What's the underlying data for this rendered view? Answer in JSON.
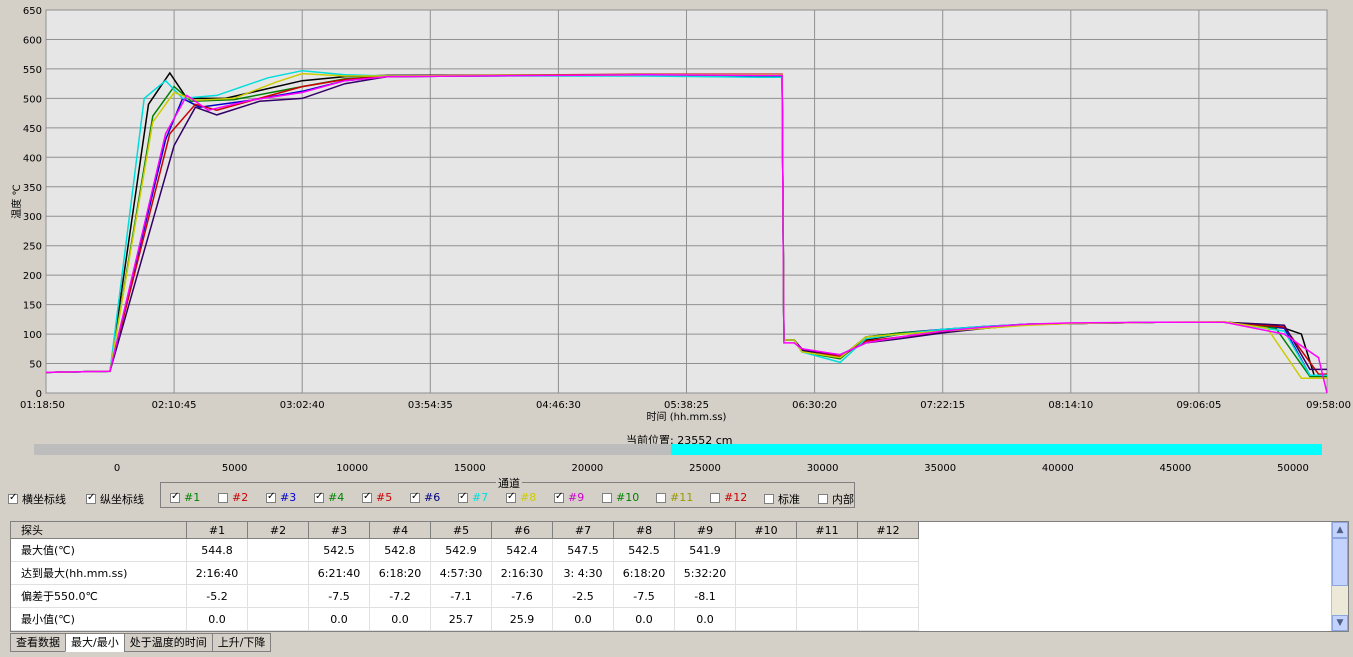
{
  "chart_data": {
    "type": "line",
    "ylabel": "温度 ℃",
    "xlabel": "时间 (hh.mm.ss)",
    "ylim": [
      0,
      650
    ],
    "yticks": [
      0,
      50,
      100,
      150,
      200,
      250,
      300,
      350,
      400,
      450,
      500,
      550,
      600,
      650
    ],
    "xticks": [
      "01:18:50",
      "02:10:45",
      "03:02:40",
      "03:54:35",
      "04:46:30",
      "05:38:25",
      "06:30:20",
      "07:22:15",
      "08:14:10",
      "09:06:05",
      "09:58:00"
    ],
    "grid": true,
    "series": [
      {
        "name": "#1",
        "color": "#000000",
        "points": [
          [
            0,
            35
          ],
          [
            0.75,
            37
          ],
          [
            1.2,
            490
          ],
          [
            1.45,
            543
          ],
          [
            1.65,
            500
          ],
          [
            2.1,
            500
          ],
          [
            3.0,
            530
          ],
          [
            3.5,
            537
          ],
          [
            4.0,
            539
          ],
          [
            7,
            540
          ],
          [
            8.4,
            540
          ],
          [
            8.62,
            540
          ],
          [
            8.64,
            90
          ],
          [
            8.76,
            90
          ],
          [
            8.85,
            72
          ],
          [
            9.3,
            60
          ],
          [
            9.6,
            90
          ],
          [
            10.0,
            100
          ],
          [
            10.5,
            105
          ],
          [
            11.0,
            112
          ],
          [
            11.5,
            117
          ],
          [
            12,
            118
          ],
          [
            13,
            120
          ],
          [
            13.8,
            120
          ],
          [
            14.4,
            115
          ],
          [
            14.7,
            100
          ],
          [
            14.85,
            30
          ],
          [
            15,
            30
          ]
        ]
      },
      {
        "name": "#3",
        "color": "#0000cc",
        "points": [
          [
            0,
            35
          ],
          [
            0.75,
            37
          ],
          [
            1.4,
            430
          ],
          [
            1.6,
            500
          ],
          [
            1.8,
            485
          ],
          [
            2.4,
            497
          ],
          [
            3.0,
            512
          ],
          [
            3.5,
            530
          ],
          [
            4.0,
            537
          ],
          [
            7,
            540
          ],
          [
            8.4,
            538
          ],
          [
            8.62,
            538
          ],
          [
            8.64,
            90
          ],
          [
            8.76,
            90
          ],
          [
            8.85,
            75
          ],
          [
            9.3,
            60
          ],
          [
            9.6,
            95
          ],
          [
            10.0,
            102
          ],
          [
            10.5,
            108
          ],
          [
            11.0,
            113
          ],
          [
            11.5,
            117
          ],
          [
            12,
            118
          ],
          [
            13,
            120
          ],
          [
            13.8,
            120
          ],
          [
            14.5,
            110
          ],
          [
            14.8,
            30
          ],
          [
            15,
            30
          ]
        ]
      },
      {
        "name": "#4",
        "color": "#008000",
        "points": [
          [
            0,
            35
          ],
          [
            0.75,
            37
          ],
          [
            1.25,
            470
          ],
          [
            1.5,
            520
          ],
          [
            1.7,
            495
          ],
          [
            2.2,
            498
          ],
          [
            3.0,
            520
          ],
          [
            3.5,
            533
          ],
          [
            4.0,
            538
          ],
          [
            7,
            540
          ],
          [
            8.4,
            539
          ],
          [
            8.62,
            539
          ],
          [
            8.64,
            90
          ],
          [
            8.76,
            90
          ],
          [
            8.85,
            70
          ],
          [
            9.3,
            58
          ],
          [
            9.6,
            95
          ],
          [
            10.0,
            102
          ],
          [
            10.5,
            107
          ],
          [
            11.0,
            112
          ],
          [
            11.5,
            116
          ],
          [
            12,
            118
          ],
          [
            13,
            120
          ],
          [
            13.8,
            120
          ],
          [
            14.4,
            110
          ],
          [
            14.8,
            28
          ],
          [
            15,
            28
          ]
        ]
      },
      {
        "name": "#5",
        "color": "#cc0000",
        "points": [
          [
            0,
            35
          ],
          [
            0.75,
            37
          ],
          [
            1.45,
            440
          ],
          [
            1.75,
            490
          ],
          [
            2.0,
            480
          ],
          [
            2.5,
            500
          ],
          [
            3.0,
            520
          ],
          [
            3.5,
            532
          ],
          [
            4.0,
            538
          ],
          [
            7,
            541
          ],
          [
            8.4,
            541
          ],
          [
            8.62,
            541
          ],
          [
            8.64,
            90
          ],
          [
            8.76,
            90
          ],
          [
            8.85,
            74
          ],
          [
            9.3,
            62
          ],
          [
            9.6,
            88
          ],
          [
            10.0,
            95
          ],
          [
            10.5,
            103
          ],
          [
            11.0,
            110
          ],
          [
            11.5,
            116
          ],
          [
            12,
            118
          ],
          [
            13,
            120
          ],
          [
            13.8,
            120
          ],
          [
            14.5,
            112
          ],
          [
            14.9,
            32
          ],
          [
            15,
            32
          ]
        ]
      },
      {
        "name": "#6",
        "color": "#330066",
        "points": [
          [
            0,
            35
          ],
          [
            0.75,
            37
          ],
          [
            1.5,
            420
          ],
          [
            1.75,
            485
          ],
          [
            2.0,
            472
          ],
          [
            2.5,
            495
          ],
          [
            3.0,
            500
          ],
          [
            3.5,
            525
          ],
          [
            4.0,
            537
          ],
          [
            7,
            540
          ],
          [
            8.4,
            540
          ],
          [
            8.62,
            540
          ],
          [
            8.64,
            90
          ],
          [
            8.76,
            90
          ],
          [
            8.85,
            73
          ],
          [
            9.3,
            65
          ],
          [
            9.6,
            85
          ],
          [
            10.0,
            92
          ],
          [
            10.5,
            102
          ],
          [
            11.0,
            110
          ],
          [
            11.5,
            116
          ],
          [
            12,
            118
          ],
          [
            13,
            120
          ],
          [
            13.8,
            120
          ],
          [
            14.5,
            115
          ],
          [
            14.8,
            40
          ],
          [
            15,
            40
          ]
        ]
      },
      {
        "name": "#7",
        "color": "#00dddd",
        "points": [
          [
            0,
            35
          ],
          [
            0.75,
            37
          ],
          [
            1.15,
            500
          ],
          [
            1.4,
            530
          ],
          [
            1.6,
            500
          ],
          [
            2.0,
            505
          ],
          [
            2.6,
            535
          ],
          [
            3.0,
            547
          ],
          [
            3.5,
            540
          ],
          [
            4.0,
            538
          ],
          [
            7,
            538
          ],
          [
            8.4,
            536
          ],
          [
            8.62,
            536
          ],
          [
            8.64,
            90
          ],
          [
            8.76,
            90
          ],
          [
            8.85,
            70
          ],
          [
            9.3,
            52
          ],
          [
            9.6,
            92
          ],
          [
            10.0,
            100
          ],
          [
            10.5,
            108
          ],
          [
            11.0,
            113
          ],
          [
            11.5,
            117
          ],
          [
            12,
            118
          ],
          [
            13,
            120
          ],
          [
            13.8,
            120
          ],
          [
            14.5,
            105
          ],
          [
            14.8,
            30
          ],
          [
            15,
            30
          ]
        ]
      },
      {
        "name": "#8",
        "color": "#cccc00",
        "points": [
          [
            0,
            35
          ],
          [
            0.75,
            37
          ],
          [
            1.25,
            460
          ],
          [
            1.5,
            510
          ],
          [
            1.75,
            497
          ],
          [
            2.2,
            500
          ],
          [
            2.7,
            528
          ],
          [
            3.0,
            542
          ],
          [
            3.5,
            538
          ],
          [
            4.0,
            538
          ],
          [
            7,
            540
          ],
          [
            8.4,
            540
          ],
          [
            8.62,
            540
          ],
          [
            8.64,
            90
          ],
          [
            8.76,
            90
          ],
          [
            8.85,
            70
          ],
          [
            9.3,
            60
          ],
          [
            9.6,
            95
          ],
          [
            10.0,
            100
          ],
          [
            10.5,
            105
          ],
          [
            11.0,
            110
          ],
          [
            11.5,
            115
          ],
          [
            12,
            118
          ],
          [
            13,
            120
          ],
          [
            13.8,
            121
          ],
          [
            14.3,
            110
          ],
          [
            14.7,
            25
          ],
          [
            15,
            25
          ]
        ]
      },
      {
        "name": "#9",
        "color": "#ff00ff",
        "points": [
          [
            0,
            35
          ],
          [
            0.75,
            37
          ],
          [
            1.4,
            440
          ],
          [
            1.65,
            505
          ],
          [
            1.9,
            480
          ],
          [
            2.4,
            497
          ],
          [
            3.0,
            510
          ],
          [
            3.5,
            530
          ],
          [
            4.0,
            537
          ],
          [
            7,
            540
          ],
          [
            8.4,
            539
          ],
          [
            8.62,
            539
          ],
          [
            8.64,
            85
          ],
          [
            8.76,
            85
          ],
          [
            8.85,
            75
          ],
          [
            9.3,
            65
          ],
          [
            9.6,
            85
          ],
          [
            10.0,
            95
          ],
          [
            10.5,
            105
          ],
          [
            11.0,
            112
          ],
          [
            11.5,
            117
          ],
          [
            12,
            119
          ],
          [
            13,
            120
          ],
          [
            13.8,
            120
          ],
          [
            14.5,
            100
          ],
          [
            14.9,
            60
          ],
          [
            15,
            0
          ]
        ]
      }
    ]
  },
  "position": {
    "label": "当前位置: 23552 cm",
    "value": 23552,
    "max": 51000
  },
  "scale": {
    "ticks": [
      "0",
      "5000",
      "10000",
      "15000",
      "20000",
      "25000",
      "30000",
      "35000",
      "40000",
      "45000",
      "50000"
    ]
  },
  "options": {
    "hgrid": {
      "label": "横坐标线",
      "checked": true
    },
    "vgrid": {
      "label": "纵坐标线",
      "checked": true
    }
  },
  "channels_title": "通道",
  "channels": [
    {
      "label": "#1",
      "checked": true,
      "color": "#008000"
    },
    {
      "label": "#2",
      "checked": false,
      "color": "#cc0000"
    },
    {
      "label": "#3",
      "checked": true,
      "color": "#0000cc"
    },
    {
      "label": "#4",
      "checked": true,
      "color": "#008000"
    },
    {
      "label": "#5",
      "checked": true,
      "color": "#cc0000"
    },
    {
      "label": "#6",
      "checked": true,
      "color": "#000080"
    },
    {
      "label": "#7",
      "checked": true,
      "color": "#00dddd"
    },
    {
      "label": "#8",
      "checked": true,
      "color": "#cccc00"
    },
    {
      "label": "#9",
      "checked": true,
      "color": "#cc00cc"
    },
    {
      "label": "#10",
      "checked": false,
      "color": "#008000"
    },
    {
      "label": "#11",
      "checked": false,
      "color": "#999900"
    },
    {
      "label": "#12",
      "checked": false,
      "color": "#cc0000"
    },
    {
      "label": "标准",
      "checked": false,
      "color": "#000000"
    },
    {
      "label": "内部",
      "checked": false,
      "color": "#000000"
    }
  ],
  "table": {
    "headers": [
      "探头",
      "#1",
      "#2",
      "#3",
      "#4",
      "#5",
      "#6",
      "#7",
      "#8",
      "#9",
      "#10",
      "#11",
      "#12"
    ],
    "rows": [
      [
        "最大值(℃)",
        "544.8",
        "",
        "542.5",
        "542.8",
        "542.9",
        "542.4",
        "547.5",
        "542.5",
        "541.9",
        "",
        "",
        ""
      ],
      [
        "达到最大(hh.mm.ss)",
        "2:16:40",
        "",
        "6:21:40",
        "6:18:20",
        "4:57:30",
        "2:16:30",
        "3: 4:30",
        "6:18:20",
        "5:32:20",
        "",
        "",
        ""
      ],
      [
        "偏差于550.0℃",
        "-5.2",
        "",
        "-7.5",
        "-7.2",
        "-7.1",
        "-7.6",
        "-2.5",
        "-7.5",
        "-8.1",
        "",
        "",
        ""
      ],
      [
        "最小值(℃)",
        "0.0",
        "",
        "0.0",
        "0.0",
        "25.7",
        "25.9",
        "0.0",
        "0.0",
        "0.0",
        "",
        "",
        ""
      ]
    ]
  },
  "tabs": [
    {
      "label": "查看数据",
      "active": false
    },
    {
      "label": "最大/最小",
      "active": true
    },
    {
      "label": "处于温度的时间",
      "active": false
    },
    {
      "label": "上升/下降",
      "active": false
    }
  ]
}
